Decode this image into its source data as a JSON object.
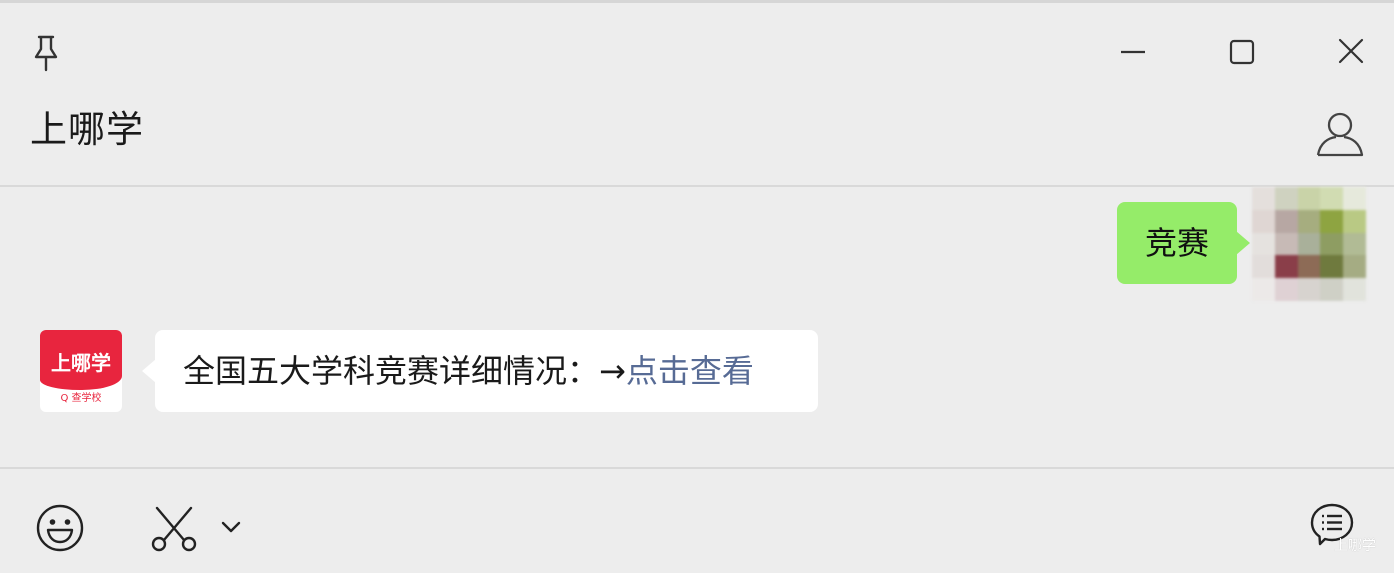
{
  "window": {
    "title": "上哪学"
  },
  "messages": {
    "outgoing": {
      "text": "竞赛"
    },
    "incoming": {
      "sender_avatar_name": "上哪学",
      "sender_avatar_sub": "Q 查学校",
      "text": "全国五大学科竞赛详细情况：→",
      "link_text": "点击查看"
    }
  },
  "user_avatar_pixels": [
    "#e4dfdc",
    "#cfd2c0",
    "#c9d3a8",
    "#d1dcb2",
    "#e6e9dc",
    "#dfd6d3",
    "#b7a7a3",
    "#a6ad7f",
    "#8ea441",
    "#b9c984",
    "#e5e2df",
    "#c7bab6",
    "#a9b09a",
    "#8e9d62",
    "#b1bb95",
    "#e2dddb",
    "#8a3e49",
    "#8d6b56",
    "#6f7a3e",
    "#a5ac83",
    "#ece9e8",
    "#dfd1d4",
    "#d7d3cf",
    "#cfd0c6",
    "#e1e3dc"
  ],
  "toolbar": {
    "icons": [
      "emoji-icon",
      "scissors-icon",
      "chevron-down-icon",
      "chat-history-icon"
    ]
  },
  "watermark": "上哪学",
  "colors": {
    "outgoing_bubble": "#95ec69",
    "incoming_bubble": "#ffffff",
    "link": "#576b95",
    "brand_red": "#e8253e",
    "background": "#ededed"
  }
}
